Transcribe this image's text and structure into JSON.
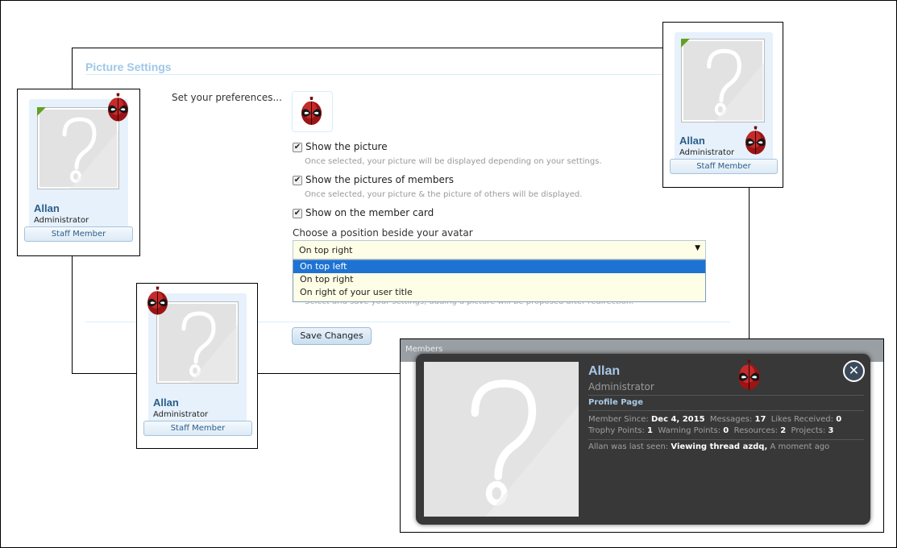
{
  "settings": {
    "title": "Picture Settings",
    "prefs_label": "Set your preferences...",
    "options": [
      {
        "label": "Show the picture",
        "checked": true,
        "hint": "Once selected, your picture will be displayed depending on your settings."
      },
      {
        "label": "Show the pictures of members",
        "checked": true,
        "hint": "Once selected, your picture & the picture of others will be displayed."
      },
      {
        "label": "Show on the member card",
        "checked": true
      }
    ],
    "position_label": "Choose a position beside your avatar",
    "position_value": "On top right",
    "position_options": [
      "On top left",
      "On top right",
      "On right of your user title"
    ],
    "bottom_hint": "Select and save your settings, adding a picture will be proposed after redirection.",
    "save_label": "Save Changes"
  },
  "cards": [
    {
      "name": "Allan",
      "role": "Administrator",
      "badge": "Staff Member"
    },
    {
      "name": "Allan",
      "role": "Administrator",
      "badge": "Staff Member"
    },
    {
      "name": "Allan",
      "role": "Administrator",
      "badge": "Staff Member"
    }
  ],
  "popup": {
    "bg_title": "Members",
    "name": "Allan",
    "role": "Administrator",
    "profile_link": "Profile Page",
    "stats": {
      "member_since_label": "Member Since:",
      "member_since": "Dec 4, 2015",
      "messages_label": "Messages:",
      "messages": "17",
      "likes_label": "Likes Received:",
      "likes": "0",
      "trophy_label": "Trophy Points:",
      "trophy": "1",
      "warning_label": "Warning Points:",
      "warning": "0",
      "resources_label": "Resources:",
      "resources": "2",
      "projects_label": "Projects:",
      "projects": "3"
    },
    "seen_prefix": "Allan was last seen:",
    "seen_action": "Viewing thread azdq,",
    "seen_time": "A moment ago",
    "close_glyph": "✕"
  },
  "icons": {
    "mask": "deadpool-mask-icon",
    "placeholder": "question-mark-placeholder",
    "corner": "green-corner-ribbon"
  },
  "colors": {
    "accent_green": "#64a023",
    "select_bg": "#fefee6",
    "selected_option": "#1e73d2",
    "popup_bg": "#383838",
    "name_blue": "#2b5d8a"
  }
}
